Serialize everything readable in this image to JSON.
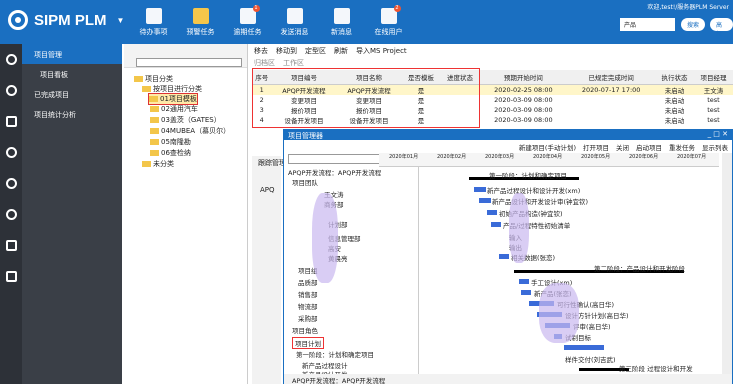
{
  "app": {
    "title": "SIPM PLM",
    "caret": "▼"
  },
  "topnav": [
    {
      "label": "待办事项",
      "badge": ""
    },
    {
      "label": "预警任务",
      "badge": ""
    },
    {
      "label": "逾期任务",
      "badge": "1"
    },
    {
      "label": "发送消息",
      "badge": ""
    },
    {
      "label": "新消息",
      "badge": ""
    },
    {
      "label": "在线用户",
      "badge": "2"
    }
  ],
  "topright": "欢迎,test!/服务器PLM Server",
  "search": {
    "value": "产品",
    "search_btn": "搜索",
    "adv_btn": "高级"
  },
  "menu": [
    {
      "label": "项目管理",
      "active": true
    },
    {
      "label": "项目看板"
    },
    {
      "label": "已完成项目"
    },
    {
      "label": "项目统计分析"
    }
  ],
  "tree": {
    "root": "项目分类",
    "child": "按项目进行分类",
    "items": [
      "01项目模板",
      "02通用汽车",
      "03盖茨（GATES）",
      "04MUBEA（慕贝尔）",
      "05南隆勘",
      "06查检纳"
    ],
    "other": "未分类"
  },
  "toolbar": [
    "移去",
    "移动到",
    "定型区",
    "刷新",
    "导入MS Project"
  ],
  "toolbar2": [
    "归档区",
    "工作区"
  ],
  "grid": {
    "headers": [
      "序号",
      "项目编号",
      "项目名称",
      "是否模板",
      "进度状态",
      "预期开始时间",
      "已规定完成时间",
      "执行状态",
      "项目经理"
    ],
    "rows": [
      [
        "1",
        "APQP开发流程",
        "APQP开发流程",
        "是",
        "",
        "2020-02-25 08:00",
        "2020-07-17 17:00",
        "未启动",
        "王文涛"
      ],
      [
        "2",
        "变更项目",
        "变更项目",
        "是",
        "",
        "2020-03-09 08:00",
        "",
        "未启动",
        "test"
      ],
      [
        "3",
        "报价项目",
        "报价项目",
        "是",
        "",
        "2020-03-09 08:00",
        "",
        "未启动",
        "test"
      ],
      [
        "4",
        "设备开发项目",
        "设备开发项目",
        "是",
        "",
        "2020-03-09 08:00",
        "",
        "未启动",
        "test"
      ]
    ]
  },
  "lower": {
    "tab": "跟踪管理",
    "tree": [
      "APQ"
    ]
  },
  "pm": {
    "title": "项目管理器",
    "tools": [
      "新建项目(手动计划)",
      "打开项目",
      "关闭",
      "启动项目",
      "重发任务",
      "显示列表"
    ],
    "tree": [
      "APQP开发流程：APQP开发流程",
      "项目团队",
      "王文涛",
      "商务部",
      "计划部",
      "信息管理部",
      "高安",
      "黄晨亮",
      "项目组",
      "品质部",
      "销售部",
      "物流部",
      "采购部",
      "项目角色",
      "项目计划",
      "第一阶段：计划和确定项目",
      "新产品过程设计",
      "新产品设计开发"
    ],
    "gantt_months": [
      "2020年01月",
      "2020年02月",
      "2020年03月",
      "2020年04月",
      "2020年05月",
      "2020年06月",
      "2020年07月"
    ],
    "gantt_labels": [
      "第一阶段：计划和确定项目",
      "新产品过程设计和设计开发(xm)",
      "新产品设计和开发设计审(钟宜钦)",
      "初始产品构造(钟宜钦)",
      "产品/过程特性初始清单",
      "输入",
      "输出",
      "相关数据(张恋)",
      "第二阶段：产品设计和开发阶段",
      "手工设计(xm)",
      "新产品(张恋)",
      "可行性确认(高日华)",
      "设计方针计划(高日华)",
      "评审(高日华)",
      "试制目标",
      "样件交付(刘吉武)",
      "第三阶段 过程设计和开发"
    ],
    "footer": "APQP开发流程：APQP开发流程"
  }
}
